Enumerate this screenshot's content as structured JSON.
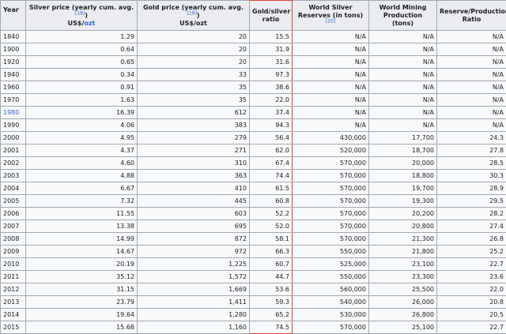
{
  "headers": {
    "year": "Year",
    "silver_a": "Silver price (yearly cum. avg.",
    "silver_ref": "[18]",
    "silver_b": ")",
    "silver_unit_a": "US$/",
    "silver_unit_link": "ozt",
    "gold_a": "Gold price (yearly cum. avg.",
    "gold_ref": "[19]",
    "gold_b": ")",
    "gold_unit": "US$/ozt",
    "ratio": "Gold/silver ratio",
    "reserves": "World Silver Reserves (in tons)",
    "reserves_ref": "[20]",
    "mining": "World Mining Production (tons)",
    "reserve_prod": "Reserve/Production Ratio"
  },
  "rows": [
    {
      "year": "1840",
      "silver": "1.29",
      "gold": "20",
      "ratio": "15.5",
      "reserves": "N/A",
      "mining": "N/A",
      "rp": "N/A"
    },
    {
      "year": "1900",
      "silver": "0.64",
      "gold": "20",
      "ratio": "31.9",
      "reserves": "N/A",
      "mining": "N/A",
      "rp": "N/A"
    },
    {
      "year": "1920",
      "silver": "0.65",
      "gold": "20",
      "ratio": "31.6",
      "reserves": "N/A",
      "mining": "N/A",
      "rp": "N/A"
    },
    {
      "year": "1940",
      "silver": "0.34",
      "gold": "33",
      "ratio": "97.3",
      "reserves": "N/A",
      "mining": "N/A",
      "rp": "N/A"
    },
    {
      "year": "1960",
      "silver": "0.91",
      "gold": "35",
      "ratio": "38.6",
      "reserves": "N/A",
      "mining": "N/A",
      "rp": "N/A"
    },
    {
      "year": "1970",
      "silver": "1.63",
      "gold": "35",
      "ratio": "22.0",
      "reserves": "N/A",
      "mining": "N/A",
      "rp": "N/A"
    },
    {
      "year": "1980",
      "silver": "16.39",
      "gold": "612",
      "ratio": "37.4",
      "reserves": "N/A",
      "mining": "N/A",
      "rp": "N/A"
    },
    {
      "year": "1990",
      "silver": "4.06",
      "gold": "383",
      "ratio": "94.3",
      "reserves": "N/A",
      "mining": "N/A",
      "rp": "N/A"
    },
    {
      "year": "2000",
      "silver": "4.95",
      "gold": "279",
      "ratio": "56.4",
      "reserves": "430,000",
      "mining": "17,700",
      "rp": "24.3"
    },
    {
      "year": "2001",
      "silver": "4.37",
      "gold": "271",
      "ratio": "62.0",
      "reserves": "520,000",
      "mining": "18,700",
      "rp": "27.8"
    },
    {
      "year": "2002",
      "silver": "4.60",
      "gold": "310",
      "ratio": "67.4",
      "reserves": "570,000",
      "mining": "20,000",
      "rp": "28.5"
    },
    {
      "year": "2003",
      "silver": "4.88",
      "gold": "363",
      "ratio": "74.4",
      "reserves": "570,000",
      "mining": "18,800",
      "rp": "30.3"
    },
    {
      "year": "2004",
      "silver": "6.67",
      "gold": "410",
      "ratio": "61.5",
      "reserves": "570,000",
      "mining": "19,700",
      "rp": "28.9"
    },
    {
      "year": "2005",
      "silver": "7.32",
      "gold": "445",
      "ratio": "60.8",
      "reserves": "570,000",
      "mining": "19,300",
      "rp": "29.5"
    },
    {
      "year": "2006",
      "silver": "11.55",
      "gold": "603",
      "ratio": "52.2",
      "reserves": "570,000",
      "mining": "20,200",
      "rp": "28.2"
    },
    {
      "year": "2007",
      "silver": "13.38",
      "gold": "695",
      "ratio": "52.0",
      "reserves": "570,000",
      "mining": "20,800",
      "rp": "27.4"
    },
    {
      "year": "2008",
      "silver": "14.99",
      "gold": "872",
      "ratio": "58.1",
      "reserves": "570,000",
      "mining": "21,300",
      "rp": "26.8"
    },
    {
      "year": "2009",
      "silver": "14.67",
      "gold": "972",
      "ratio": "66.3",
      "reserves": "550,000",
      "mining": "21,800",
      "rp": "25.2"
    },
    {
      "year": "2010",
      "silver": "20.19",
      "gold": "1,225",
      "ratio": "60.7",
      "reserves": "525,000",
      "mining": "23,100",
      "rp": "22.7"
    },
    {
      "year": "2011",
      "silver": "35.12",
      "gold": "1,572",
      "ratio": "44.7",
      "reserves": "550,000",
      "mining": "23,300",
      "rp": "23.6"
    },
    {
      "year": "2012",
      "silver": "31.15",
      "gold": "1,669",
      "ratio": "53.6",
      "reserves": "560,000",
      "mining": "25,500",
      "rp": "22.0"
    },
    {
      "year": "2013",
      "silver": "23.79",
      "gold": "1,411",
      "ratio": "59.3",
      "reserves": "540,000",
      "mining": "26,000",
      "rp": "20.8"
    },
    {
      "year": "2014",
      "silver": "19.64",
      "gold": "1,280",
      "ratio": "65.2",
      "reserves": "530,000",
      "mining": "26,800",
      "rp": "20.5"
    },
    {
      "year": "2015",
      "silver": "15.68",
      "gold": "1,160",
      "ratio": "74.5",
      "reserves": "570,000",
      "mining": "25,100",
      "rp": "22.7"
    }
  ],
  "linked_years": [
    "1980"
  ],
  "colors": {
    "header_bg": "#eaecf0",
    "cell_bg": "#f8f9fa",
    "border": "#a2a9b1",
    "link": "#3366cc",
    "highlight": "#e0403a"
  }
}
